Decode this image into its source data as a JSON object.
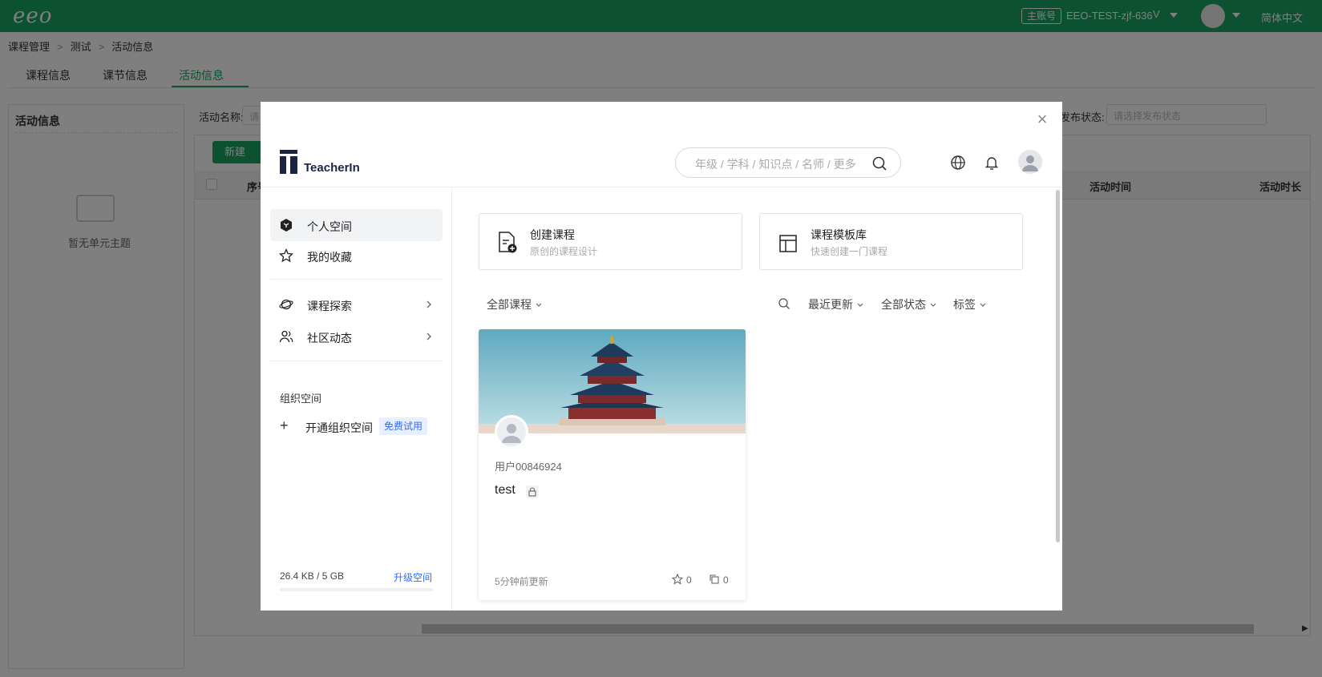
{
  "topbar": {
    "logo": "eeo",
    "account_badge": "主账号",
    "account_name": "EEO-TEST-zjf-636",
    "account_icon": "V",
    "language": "简体中文"
  },
  "breadcrumb": [
    "课程管理",
    "测试",
    "活动信息"
  ],
  "tabs": [
    "课程信息",
    "课节信息",
    "活动信息"
  ],
  "left_panel": {
    "title": "活动信息",
    "empty_text": "暂无单元主题"
  },
  "filters": {
    "activity_name_label": "活动名称:",
    "activity_name_placeholder": "请",
    "publish_label": "发布状态:",
    "publish_placeholder": "请选择发布状态"
  },
  "table": {
    "new_button": "新建",
    "headers": [
      "序号",
      "活动时间",
      "活动时长"
    ]
  },
  "modal": {
    "brand": "TeacherIn",
    "search_placeholder": "年级 / 学科 / 知识点 / 名师 / 更多",
    "nav": [
      {
        "label": "个人空间",
        "icon": "cube-icon"
      },
      {
        "label": "我的收藏",
        "icon": "star-icon"
      },
      {
        "label": "课程探索",
        "icon": "planet-icon"
      },
      {
        "label": "社区动态",
        "icon": "users-icon"
      }
    ],
    "org": {
      "title": "组织空间",
      "open_label": "开通组织空间",
      "free_badge": "免费试用"
    },
    "storage": {
      "usage": "26.4 KB / 5 GB",
      "upgrade": "升级空间"
    },
    "quick_actions": [
      {
        "title": "创建课程",
        "subtitle": "原创的课程设计"
      },
      {
        "title": "课程模板库",
        "subtitle": "快速创建一门课程"
      }
    ],
    "filter_bar": {
      "all_courses": "全部课程",
      "recent": "最近更新",
      "all_status": "全部状态",
      "tags": "标签"
    },
    "course_card": {
      "user": "用户00846924",
      "title": "test",
      "updated": "5分钟前更新",
      "stars": "0",
      "copies": "0"
    }
  },
  "colors": {
    "brand_green": "#19a462",
    "link_blue": "#2f6bff",
    "teacherin_navy": "#1a2340"
  }
}
